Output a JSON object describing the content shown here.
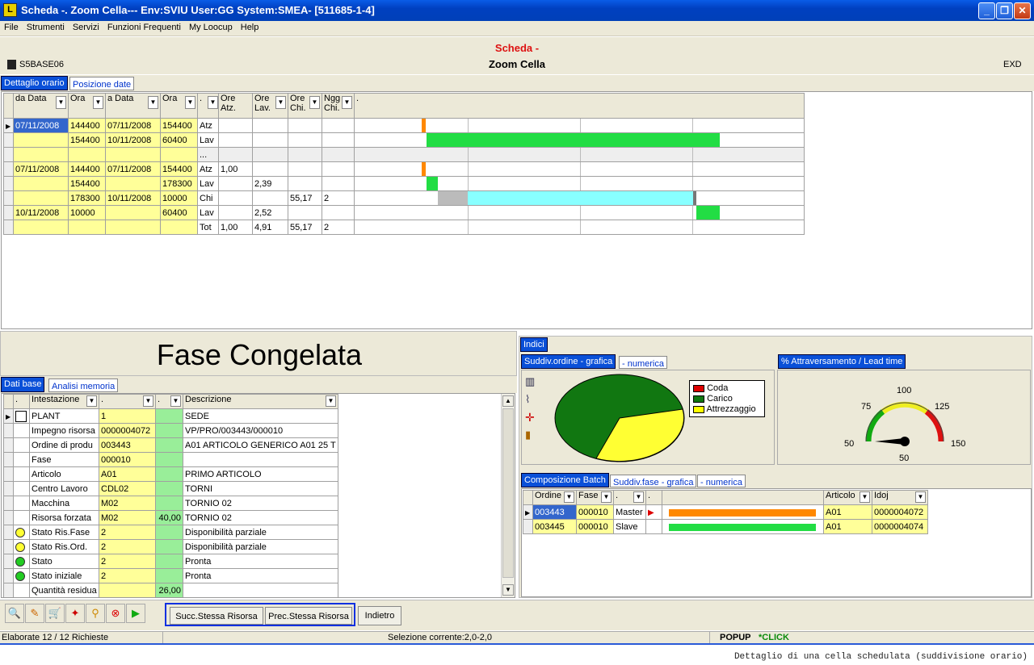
{
  "window": {
    "title": "Scheda -. Zoom Cella--- Env:SVIU User:GG System:SMEA- [511685-1-4]",
    "min": "_",
    "max": "❐",
    "close": "✕",
    "logo": "L"
  },
  "menu": [
    "File",
    "Strumenti",
    "Servizi",
    "Funzioni Frequenti",
    "My Loocup",
    "Help"
  ],
  "header": {
    "title1": "Scheda -",
    "title2": "Zoom Cella",
    "left_code": "S5BASE06",
    "right_code": "EXD"
  },
  "top_tabs": [
    "Dettaglio orario",
    "Posizione date"
  ],
  "top_grid": {
    "headers": [
      "da Data",
      "Ora",
      "a Data",
      "Ora",
      ".",
      "Ore Atz.",
      "Ore Lav.",
      "Ore Chi.",
      "Ngg Chi.",
      "."
    ],
    "rows": [
      [
        "07/11/2008",
        "144400",
        "07/11/2008",
        "154400",
        "Atz",
        "",
        "",
        "",
        ""
      ],
      [
        "",
        "154400",
        "10/11/2008",
        "60400",
        "Lav",
        "",
        "",
        "",
        ""
      ],
      [
        "",
        "",
        "",
        "",
        "...",
        "",
        "",
        "",
        ""
      ],
      [
        "07/11/2008",
        "144400",
        "07/11/2008",
        "154400",
        "Atz",
        "1,00",
        "",
        "",
        ""
      ],
      [
        "",
        "154400",
        "",
        "178300",
        "Lav",
        "",
        "2,39",
        "",
        ""
      ],
      [
        "",
        "178300",
        "10/11/2008",
        "10000",
        "Chi",
        "",
        "",
        "55,17",
        "2"
      ],
      [
        "10/11/2008",
        "10000",
        "",
        "60400",
        "Lav",
        "",
        "2,52",
        "",
        ""
      ],
      [
        "",
        "",
        "",
        "",
        "Tot",
        "1,00",
        "4,91",
        "55,17",
        "2"
      ]
    ]
  },
  "banner": "Fase Congelata",
  "left_tabs": [
    "Dati base",
    "Analisi memoria"
  ],
  "left_grid": {
    "headers": [
      ".",
      "Intestazione",
      ".",
      ".",
      "Descrizione"
    ],
    "rows": [
      [
        "",
        "PLANT",
        "1",
        "",
        "SEDE"
      ],
      [
        "",
        "Impegno risorsa",
        "0000004072",
        "",
        "VP/PRO/003443/000010"
      ],
      [
        "",
        "Ordine di produ",
        "003443",
        "",
        "A01 ARTICOLO GENERICO A01 25 T"
      ],
      [
        "",
        "Fase",
        "000010",
        "",
        ""
      ],
      [
        "",
        "Articolo",
        "A01",
        "",
        "PRIMO ARTICOLO"
      ],
      [
        "",
        "Centro Lavoro",
        "CDL02",
        "",
        "TORNI"
      ],
      [
        "",
        "Macchina",
        "M02",
        "",
        "TORNIO 02"
      ],
      [
        "",
        "Risorsa forzata",
        "M02",
        "40,00",
        "TORNIO 02"
      ],
      [
        "yellow",
        "Stato Ris.Fase",
        "2",
        "",
        "Disponibilità parziale"
      ],
      [
        "yellow",
        "Stato Ris.Ord.",
        "2",
        "",
        "Disponibilità parziale"
      ],
      [
        "green",
        "Stato",
        "2",
        "",
        "Pronta"
      ],
      [
        "green",
        "Stato iniziale",
        "2",
        "",
        "Pronta"
      ],
      [
        "",
        "Quantità residua",
        "",
        "26,00",
        ""
      ]
    ]
  },
  "indici": "Indici",
  "pie_tabs": [
    "Suddiv.ordine - grafica",
    "- numerica"
  ],
  "legend": [
    {
      "label": "Coda",
      "color": "#dd0000"
    },
    {
      "label": "Carico",
      "color": "#117711"
    },
    {
      "label": "Attrezzaggio",
      "color": "#ffff00"
    }
  ],
  "gauge": {
    "title": "% Attraversamento / Lead time",
    "labels": [
      "50",
      "75",
      "100",
      "125",
      "150"
    ],
    "value_label": "50"
  },
  "batch_tabs": [
    "Composizione Batch",
    "Suddiv.fase - grafica",
    "- numerica"
  ],
  "batch_grid": {
    "headers": [
      "Ordine",
      "Fase",
      ".",
      ".",
      "Articolo",
      "Idoj"
    ],
    "rows": [
      [
        "003443",
        "000010",
        "Master",
        "",
        "A01",
        "0000004072"
      ],
      [
        "003445",
        "000010",
        "Slave",
        "",
        "A01",
        "0000004074"
      ]
    ]
  },
  "buttons": {
    "succ": "Succ.Stessa Risorsa",
    "prec": "Prec.Stessa Risorsa",
    "back": "Indietro"
  },
  "toolbar_icons": [
    "search-icon",
    "edit-icon",
    "cart-icon",
    "wand-icon",
    "zoom-icon",
    "stop-icon",
    "play-icon"
  ],
  "status": {
    "left": "Elaborate 12 / 12 Richieste",
    "mid": "Selezione corrente:2,0-2,0",
    "popup": "POPUP",
    "click": "*CLICK"
  },
  "caption": "Dettaglio di una cella schedulata (suddivisione orario)"
}
